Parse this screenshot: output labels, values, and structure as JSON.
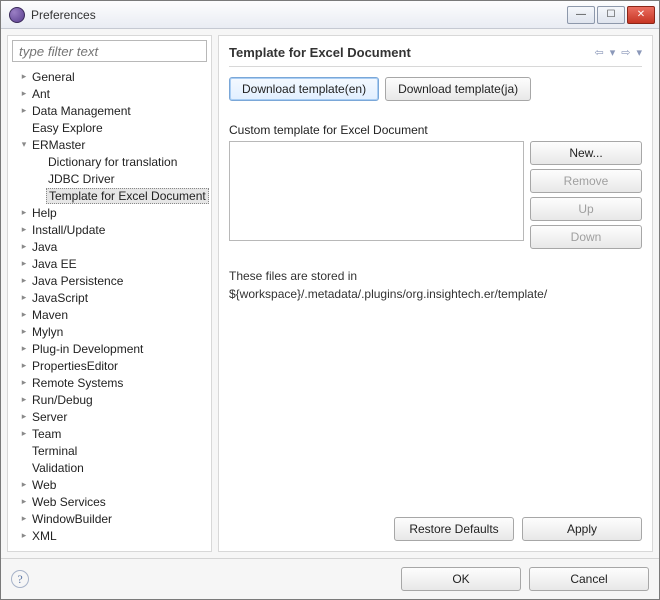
{
  "window": {
    "title": "Preferences"
  },
  "filter": {
    "placeholder": "type filter text"
  },
  "tree": [
    {
      "label": "General",
      "level": 0,
      "expandable": true,
      "expanded": false
    },
    {
      "label": "Ant",
      "level": 0,
      "expandable": true,
      "expanded": false
    },
    {
      "label": "Data Management",
      "level": 0,
      "expandable": true,
      "expanded": false
    },
    {
      "label": "Easy Explore",
      "level": 0,
      "expandable": false,
      "expanded": false
    },
    {
      "label": "ERMaster",
      "level": 0,
      "expandable": true,
      "expanded": true
    },
    {
      "label": "Dictionary for translation",
      "level": 1,
      "expandable": false,
      "expanded": false
    },
    {
      "label": "JDBC Driver",
      "level": 1,
      "expandable": false,
      "expanded": false
    },
    {
      "label": "Template for Excel Document",
      "level": 1,
      "expandable": false,
      "expanded": false,
      "selected": true
    },
    {
      "label": "Help",
      "level": 0,
      "expandable": true,
      "expanded": false
    },
    {
      "label": "Install/Update",
      "level": 0,
      "expandable": true,
      "expanded": false
    },
    {
      "label": "Java",
      "level": 0,
      "expandable": true,
      "expanded": false
    },
    {
      "label": "Java EE",
      "level": 0,
      "expandable": true,
      "expanded": false
    },
    {
      "label": "Java Persistence",
      "level": 0,
      "expandable": true,
      "expanded": false
    },
    {
      "label": "JavaScript",
      "level": 0,
      "expandable": true,
      "expanded": false
    },
    {
      "label": "Maven",
      "level": 0,
      "expandable": true,
      "expanded": false
    },
    {
      "label": "Mylyn",
      "level": 0,
      "expandable": true,
      "expanded": false
    },
    {
      "label": "Plug-in Development",
      "level": 0,
      "expandable": true,
      "expanded": false
    },
    {
      "label": "PropertiesEditor",
      "level": 0,
      "expandable": true,
      "expanded": false
    },
    {
      "label": "Remote Systems",
      "level": 0,
      "expandable": true,
      "expanded": false
    },
    {
      "label": "Run/Debug",
      "level": 0,
      "expandable": true,
      "expanded": false
    },
    {
      "label": "Server",
      "level": 0,
      "expandable": true,
      "expanded": false
    },
    {
      "label": "Team",
      "level": 0,
      "expandable": true,
      "expanded": false
    },
    {
      "label": "Terminal",
      "level": 0,
      "expandable": false,
      "expanded": false
    },
    {
      "label": "Validation",
      "level": 0,
      "expandable": false,
      "expanded": false
    },
    {
      "label": "Web",
      "level": 0,
      "expandable": true,
      "expanded": false
    },
    {
      "label": "Web Services",
      "level": 0,
      "expandable": true,
      "expanded": false
    },
    {
      "label": "WindowBuilder",
      "level": 0,
      "expandable": true,
      "expanded": false
    },
    {
      "label": "XML",
      "level": 0,
      "expandable": true,
      "expanded": false
    }
  ],
  "pane": {
    "title": "Template for Excel Document",
    "download_en": "Download template(en)",
    "download_ja": "Download template(ja)",
    "custom_label": "Custom template for Excel Document",
    "new_btn": "New...",
    "remove_btn": "Remove",
    "up_btn": "Up",
    "down_btn": "Down",
    "info_line1": "These files are stored in",
    "info_line2": "${workspace}/.metadata/.plugins/org.insightech.er/template/",
    "restore_btn": "Restore Defaults",
    "apply_btn": "Apply"
  },
  "bottom": {
    "ok": "OK",
    "cancel": "Cancel"
  }
}
